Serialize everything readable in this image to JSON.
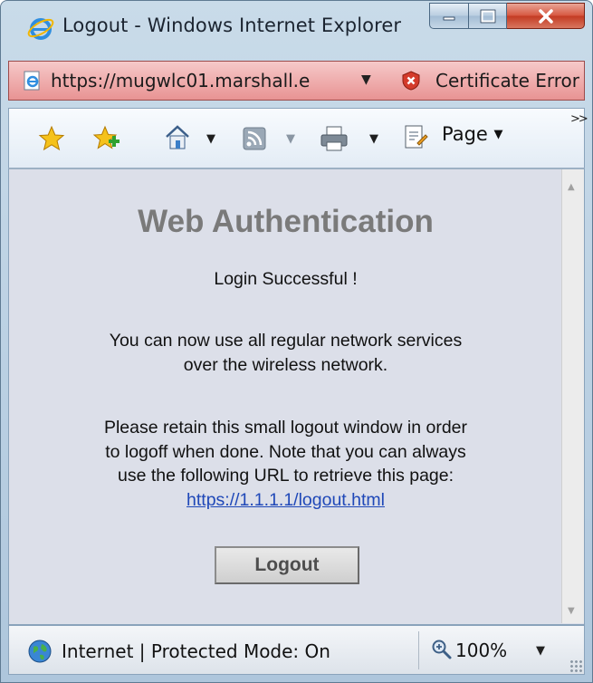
{
  "window": {
    "title": "Logout - Windows Internet Explorer"
  },
  "address_bar": {
    "url": "https://mugwlc01.marshall.e",
    "certificate_error": "Certificate Error"
  },
  "command_bar": {
    "page_label": "Page",
    "icons": [
      "favorites-star-icon",
      "add-favorites-icon",
      "home-icon",
      "feeds-icon",
      "print-icon",
      "page-icon"
    ]
  },
  "content": {
    "heading": "Web Authentication",
    "login_message": "Login Successful !",
    "network_message": [
      "You can now use all regular network services",
      "over the wireless network."
    ],
    "retain_message": [
      "Please retain this small logout window in order",
      "to logoff when done. Note that you can always",
      "use the following URL to retrieve this page:"
    ],
    "logout_url": "https://1.1.1.1/logout.html",
    "logout_button": "Logout"
  },
  "status_bar": {
    "zone_text": "Internet | Protected Mode: On",
    "zoom": "100%"
  },
  "colors": {
    "certificate_error_bg": "#e89393",
    "content_bg": "#dcdfe9",
    "heading_gray": "#7a7a7a",
    "link_blue": "#1f48b8"
  }
}
